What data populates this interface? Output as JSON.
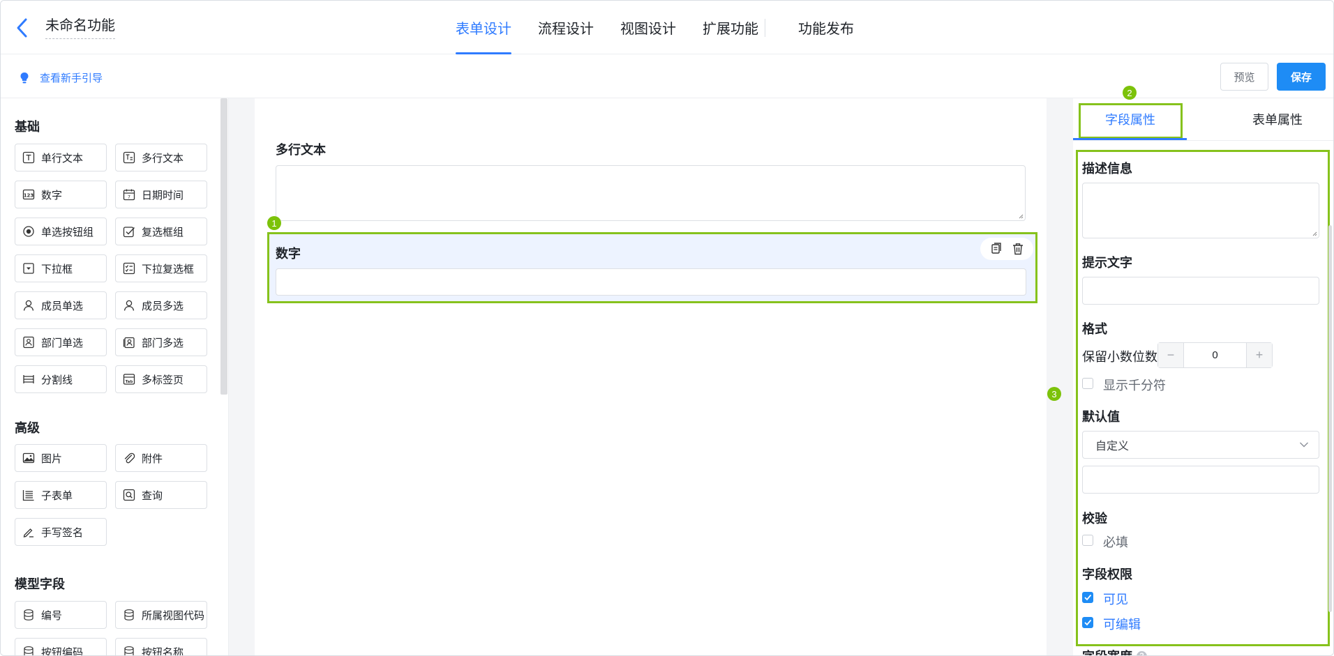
{
  "header": {
    "app_title": "未命名功能",
    "tabs": [
      {
        "label": "表单设计",
        "active": true
      },
      {
        "label": "流程设计",
        "active": false
      },
      {
        "label": "视图设计",
        "active": false
      },
      {
        "label": "扩展功能",
        "active": false
      },
      {
        "label": "功能发布",
        "active": false
      }
    ],
    "back_icon": "chevron-left-icon"
  },
  "toolbar": {
    "guide_label": "查看新手引导",
    "preview_label": "预览",
    "save_label": "保存"
  },
  "palette": {
    "groups": [
      {
        "title": "基础",
        "items": [
          "单行文本",
          "多行文本",
          "数字",
          "日期时间",
          "单选按钮组",
          "复选框组",
          "下拉框",
          "下拉复选框",
          "成员单选",
          "成员多选",
          "部门单选",
          "部门多选",
          "分割线",
          "多标签页"
        ]
      },
      {
        "title": "高级",
        "items": [
          "图片",
          "附件",
          "子表单",
          "查询",
          "手写签名"
        ]
      },
      {
        "title": "模型字段",
        "items": [
          "编号",
          "所属视图代码",
          "按钮编码",
          "按钮名称"
        ]
      }
    ]
  },
  "canvas": {
    "fields": [
      {
        "label": "多行文本"
      },
      {
        "label": "数字"
      }
    ],
    "badges": [
      "1",
      "2",
      "3"
    ]
  },
  "props": {
    "tab_field": "字段属性",
    "tab_form": "表单属性",
    "desc_title": "描述信息",
    "hint_title": "提示文字",
    "format_title": "格式",
    "decimal_label": "保留小数位数",
    "decimal_value": "0",
    "minus": "−",
    "plus": "+",
    "thousand_label": "显示千分符",
    "default_title": "默认值",
    "default_select": "自定义",
    "verify_title": "校验",
    "required_label": "必填",
    "perm_title": "字段权限",
    "visible_label": "可见",
    "editable_label": "可编辑",
    "width_title": "字段宽度"
  },
  "colors": {
    "accent": "#2f7bff",
    "highlight": "#86c21c",
    "primary_button": "#1e8cf5"
  }
}
